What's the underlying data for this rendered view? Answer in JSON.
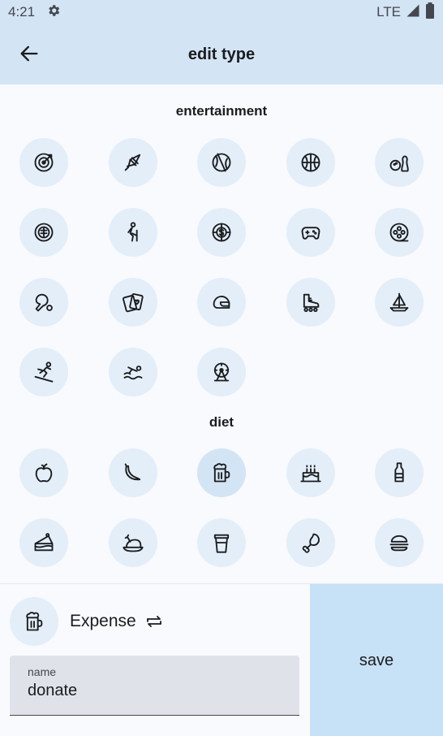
{
  "status": {
    "time": "4:21",
    "network": "LTE"
  },
  "appbar": {
    "title": "edit type"
  },
  "sections": [
    {
      "title": "entertainment",
      "icons": [
        "dart-target",
        "badminton",
        "baseball",
        "basketball",
        "bowling",
        "mahjong",
        "hiking",
        "casino-chip",
        "gamepad",
        "film-reel",
        "ping-pong",
        "playing-cards",
        "helmet",
        "roller-skate",
        "sailboat",
        "skiing",
        "swimming",
        "ferris-wheel"
      ]
    },
    {
      "title": "diet",
      "icons": [
        "apple",
        "banana",
        "beer-mug",
        "birthday-cake",
        "bottle",
        "cake-slice",
        "roast-chicken",
        "coffee-cup",
        "chicken-leg",
        "burger"
      ]
    }
  ],
  "bottom": {
    "selected_icon": "beer-mug",
    "type_label": "Expense",
    "name_label": "name",
    "name_value": "donate",
    "save_label": "save"
  }
}
